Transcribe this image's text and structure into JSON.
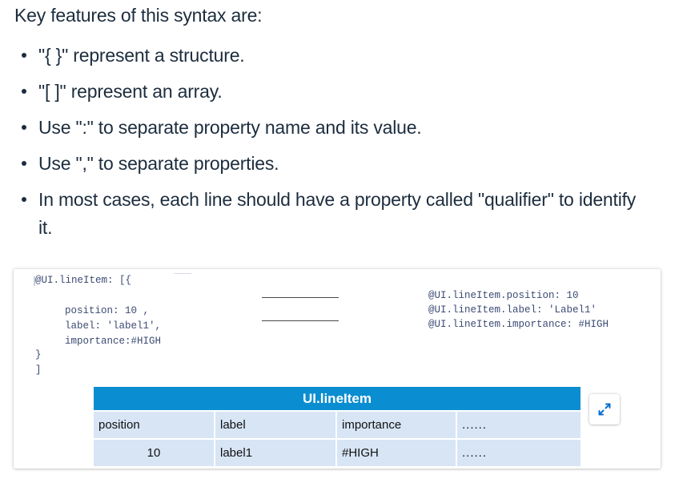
{
  "intro": "Key features of this syntax are:",
  "features": [
    "\"{ }\" represent a structure.",
    "\"[ ]\" represent an array.",
    "Use \":\" to separate property name and its value.",
    "Use \",\" to separate properties.",
    "In most cases, each line should have a property called \"qualifier\" to identify it."
  ],
  "figure": {
    "code_left": {
      "line1": "@UI.lineItem: [{",
      "line2": "position: 10 ,",
      "line3": "label: 'label1',",
      "line4": "importance:#HIGH",
      "line5": "}",
      "line6": "]"
    },
    "code_right": [
      "@UI.lineItem.position: 10",
      "@UI.lineItem.label: 'Label1'",
      "@UI.lineItem.importance: #HIGH"
    ],
    "table": {
      "title": "UI.lineItem",
      "header_row": [
        "position",
        "label",
        "importance",
        "......"
      ],
      "data_row": [
        "10",
        "label1",
        "#HIGH",
        "......"
      ]
    },
    "expand_icon": "expand-diagonal-arrows-icon",
    "accent_color": "#0a8ed1",
    "row_color": "#d7e5f5"
  }
}
